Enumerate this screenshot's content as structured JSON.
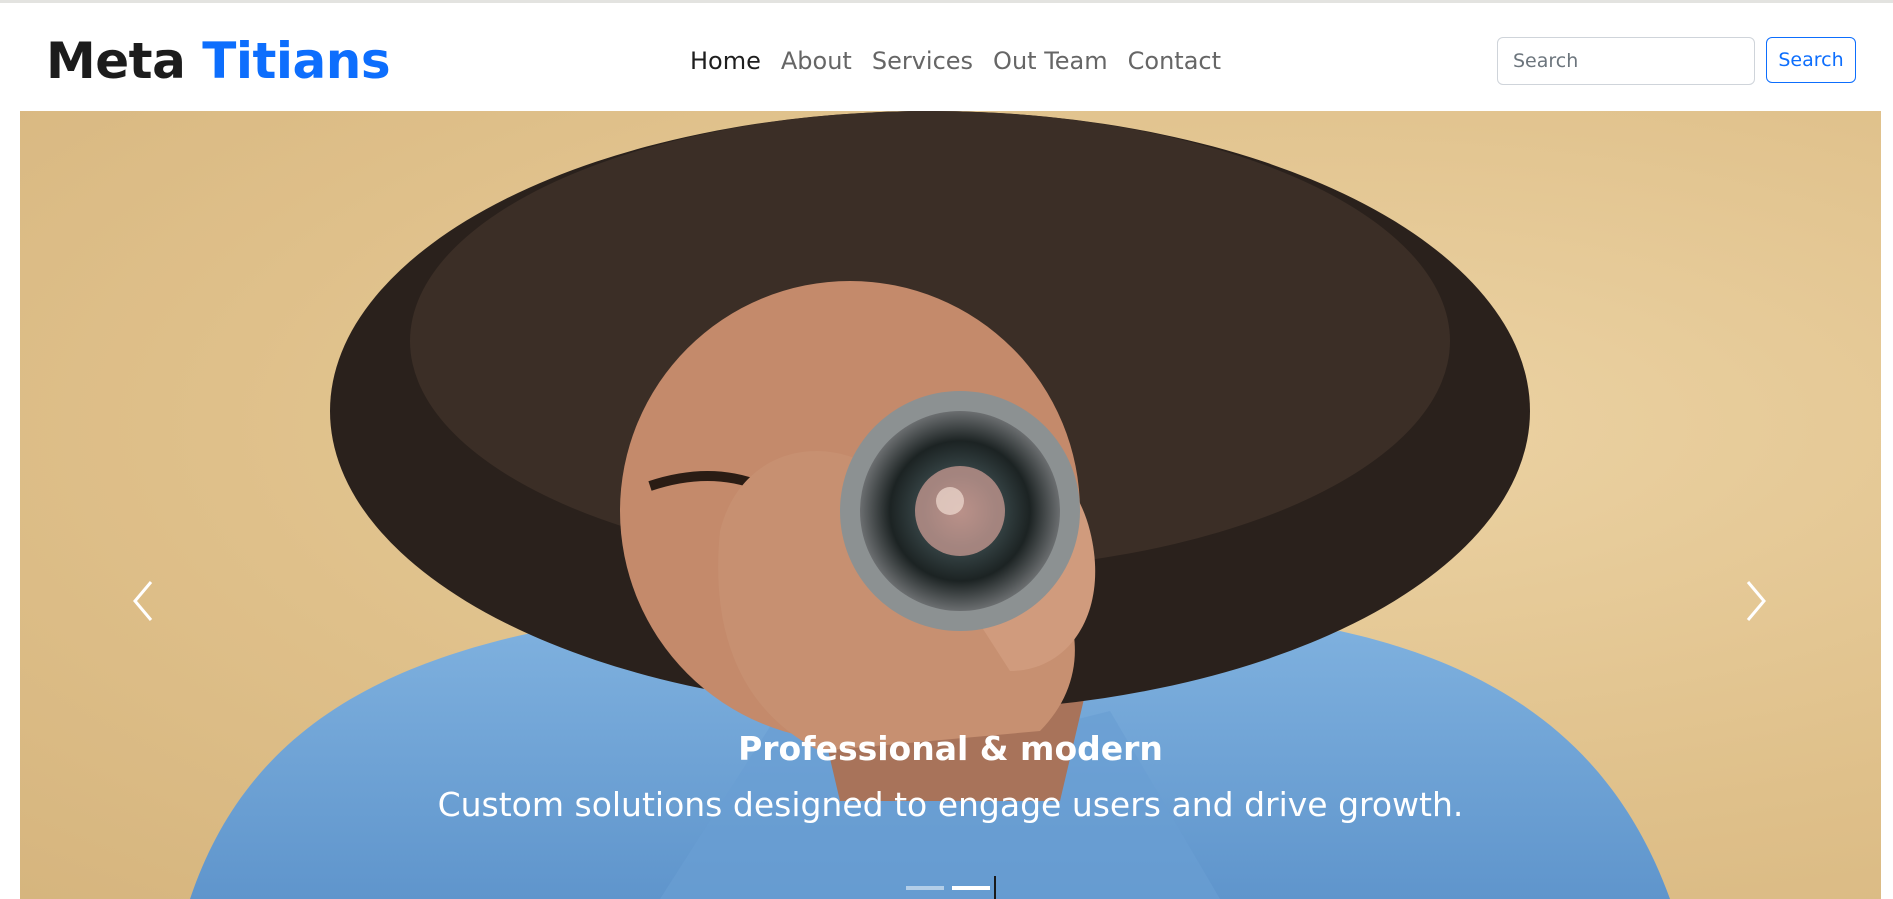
{
  "brand": {
    "part1": "Meta",
    "part2": "Titians"
  },
  "nav": {
    "items": [
      {
        "label": "Home",
        "active": true
      },
      {
        "label": "About",
        "active": false
      },
      {
        "label": "Services",
        "active": false
      },
      {
        "label": "Out Team",
        "active": false
      },
      {
        "label": "Contact",
        "active": false
      }
    ]
  },
  "search": {
    "placeholder": "Search",
    "value": "",
    "button_label": "Search"
  },
  "hero": {
    "caption_title": "Professional & modern",
    "caption_text": "Custom solutions designed to engage users and drive growth.",
    "slide_count": 2,
    "active_slide": 2
  },
  "icons": {
    "prev": "chevron-left-icon",
    "next": "chevron-right-icon"
  },
  "colors": {
    "accent": "#0d6efd",
    "brand_dark": "#1c1c1c",
    "hero_bg": "#e2c691",
    "shirt": "#6fa3d6"
  }
}
